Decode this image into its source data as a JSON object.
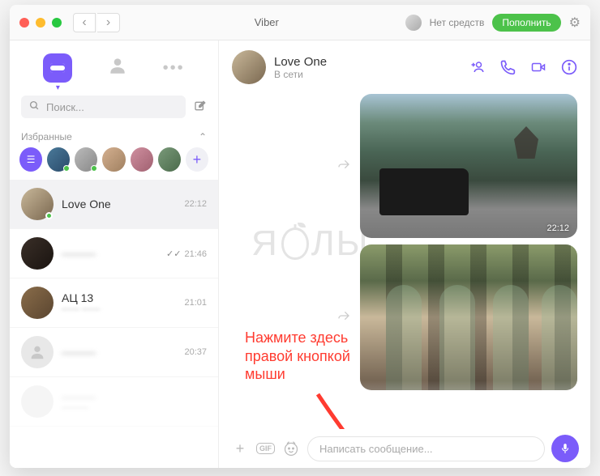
{
  "app": {
    "title": "Viber"
  },
  "header": {
    "balance_label": "Нет средств",
    "topup_label": "Пополнить"
  },
  "sidebar": {
    "search_placeholder": "Поиск...",
    "favorites_label": "Избранные",
    "chats": [
      {
        "name": "Love One",
        "time": "22:12",
        "online": true,
        "selected": true
      },
      {
        "name": "———",
        "time": "21:46",
        "checks": true
      },
      {
        "name": "АЦ 13",
        "time": "21:01"
      },
      {
        "name": "———",
        "time": "20:37"
      },
      {
        "name": "———",
        "time": ""
      }
    ]
  },
  "chat": {
    "title": "Love One",
    "status": "В сети",
    "msg1_time": "22:12",
    "input_placeholder": "Написать сообщение..."
  },
  "annotation": {
    "line1": "Нажмите здесь",
    "line2": "правой кнопкой",
    "line3": "мыши"
  },
  "watermark": {
    "left": "Я",
    "right": "ЛЫ"
  }
}
